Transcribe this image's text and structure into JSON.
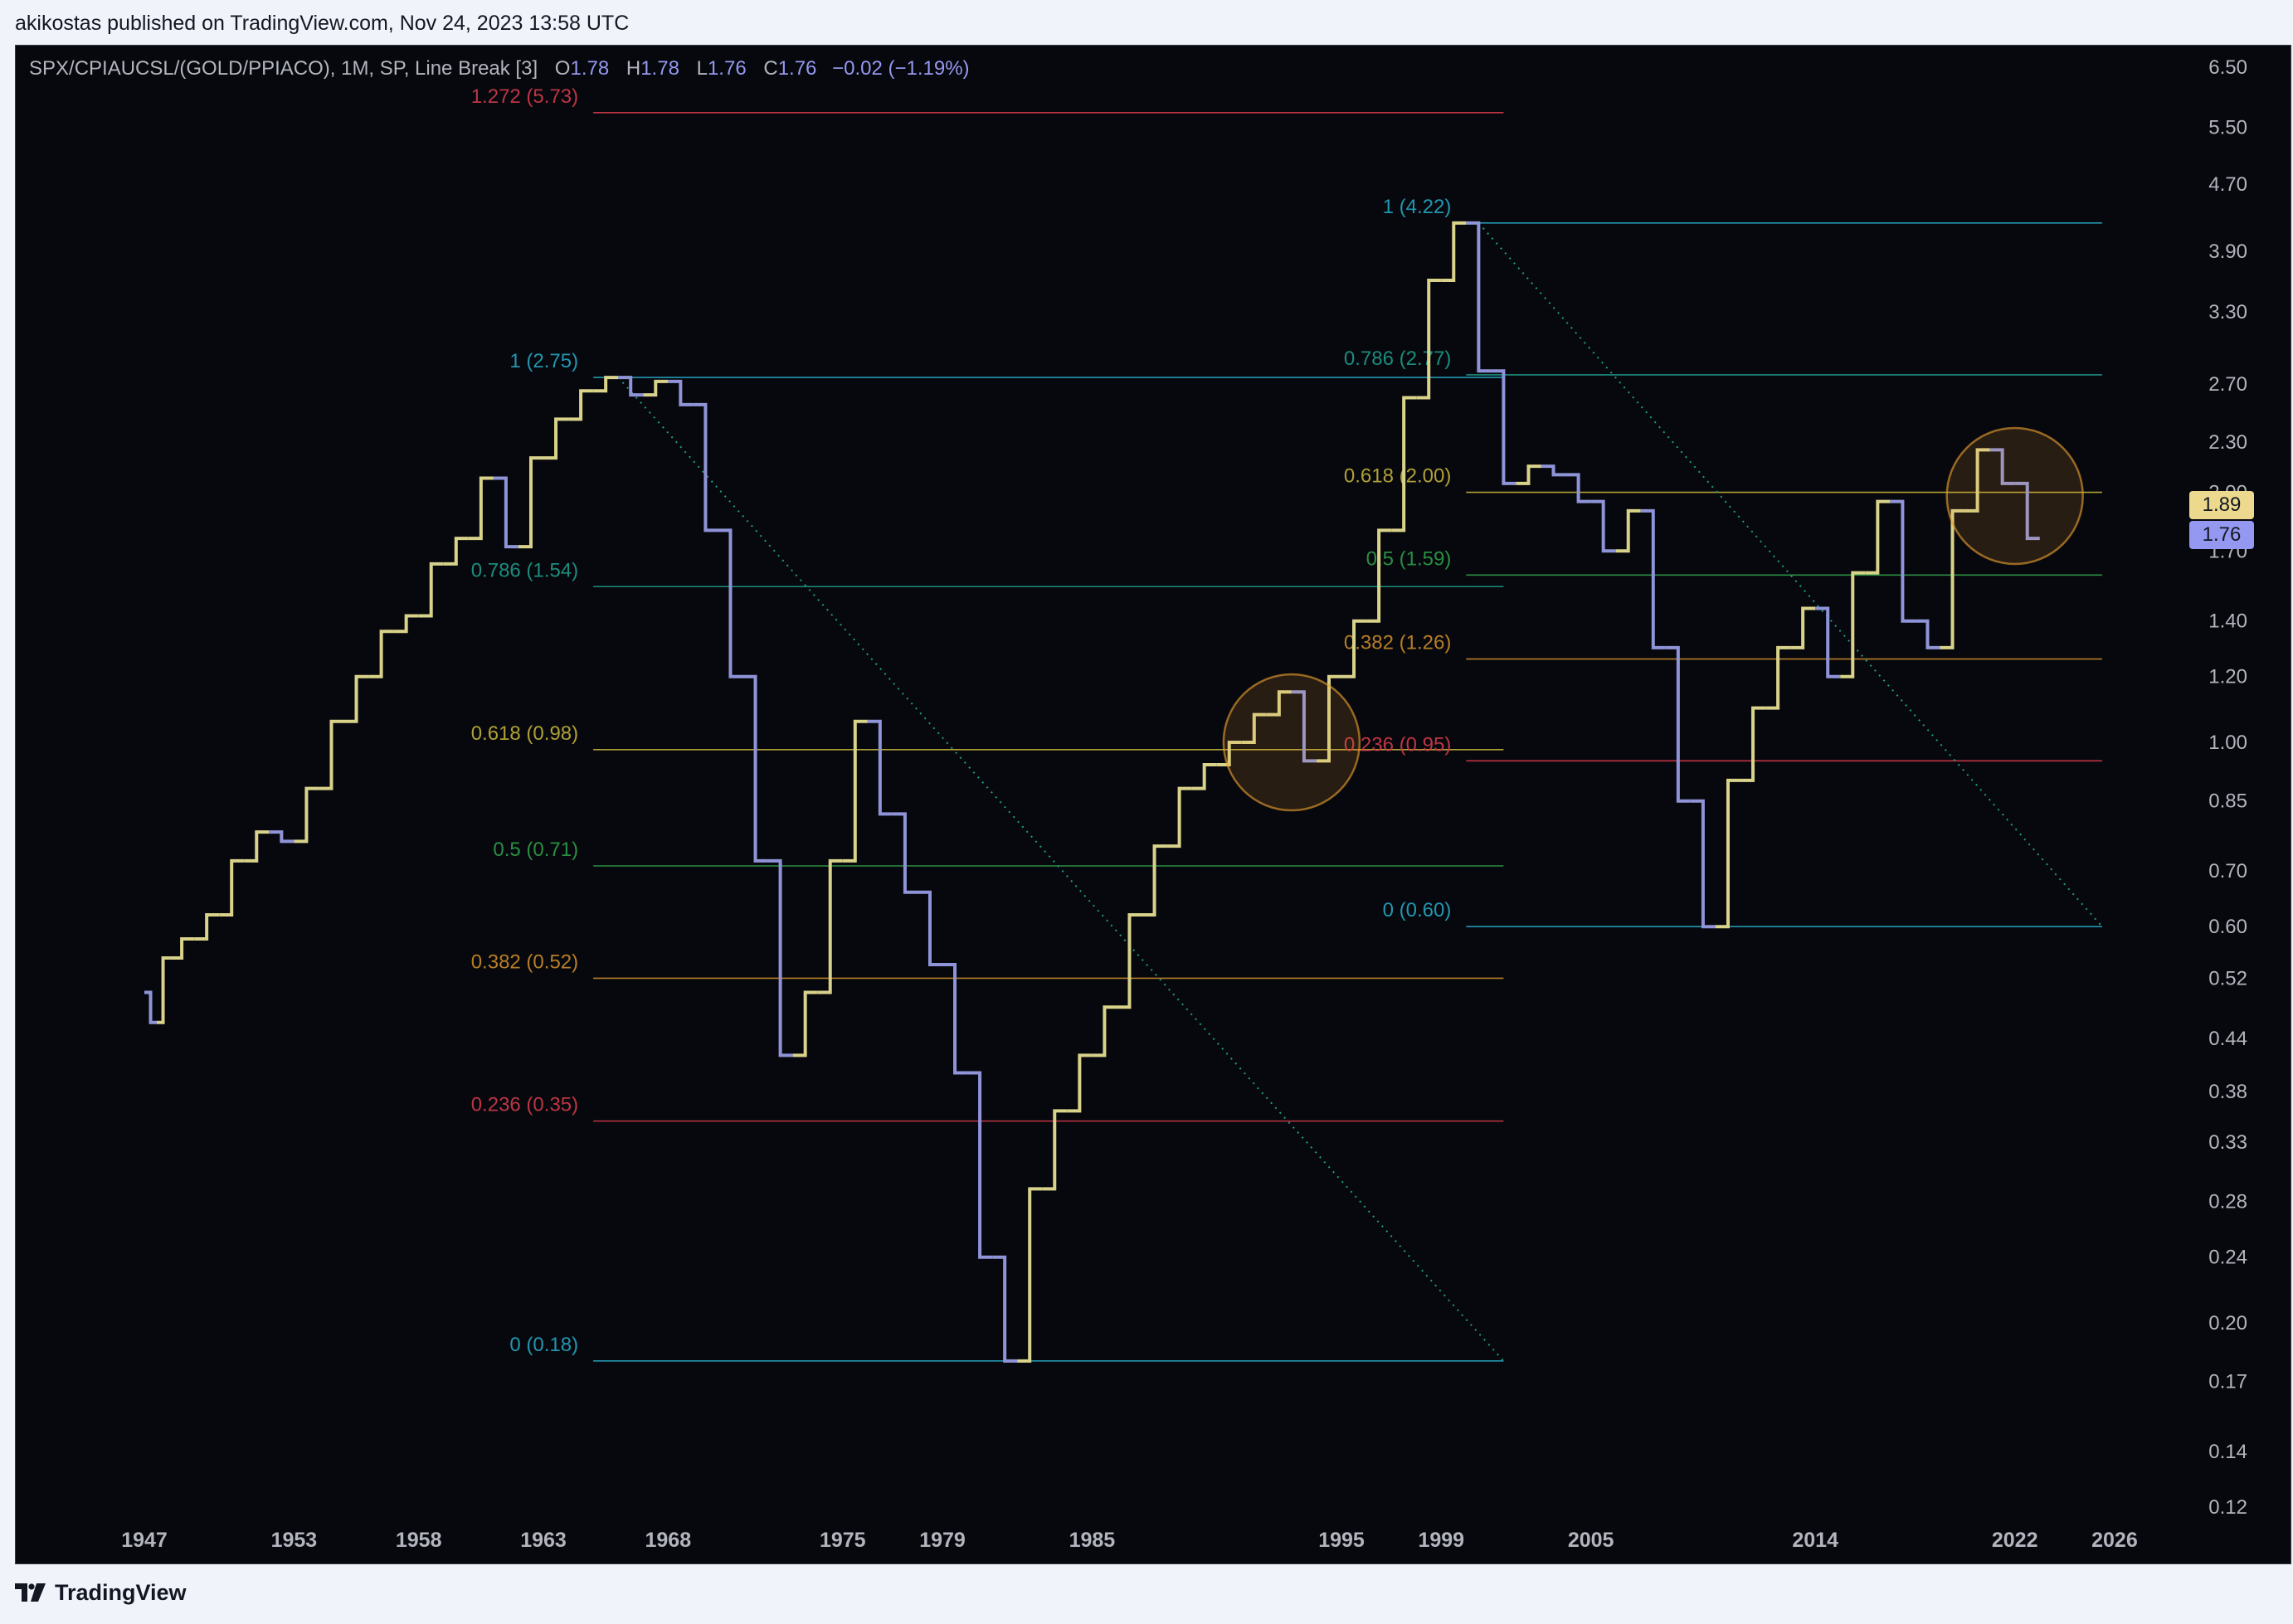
{
  "attribution": "akikostas published on TradingView.com, Nov 24, 2023 13:58 UTC",
  "legend": {
    "symbol": "SPX/CPIAUCSL/(GOLD/PPIACO), 1M, SP, Line Break [3]",
    "open_label": "O",
    "open": "1.78",
    "high_label": "H",
    "high": "1.78",
    "low_label": "L",
    "low": "1.76",
    "close_label": "C",
    "close": "1.76",
    "change": "−0.02 (−1.19%)"
  },
  "price_tags": {
    "upper": {
      "value": "1.89",
      "color": "#ecd98d"
    },
    "lower": {
      "value": "1.76",
      "color": "#9598f0"
    }
  },
  "footer": {
    "brand": "TradingView",
    "logo_icon": "tradingview-logo-icon"
  },
  "colors": {
    "up": "#d8d28a",
    "down": "#8f94d8",
    "background": "#07080d",
    "fib_1": "#26a6c2",
    "fib_0786": "#1f9b8a",
    "fib_0618": "#c2b13c",
    "fib_05": "#2e9e48",
    "fib_0382": "#c98b2a",
    "fib_0236": "#d13a4a",
    "fib_1272": "#d13a4a",
    "circle": "#f0a330"
  },
  "chart_data": {
    "type": "line",
    "scale": "log",
    "ylim": [
      0.11,
      6.9
    ],
    "y_ticks": [
      "6.50",
      "5.50",
      "4.70",
      "3.90",
      "3.30",
      "2.70",
      "2.30",
      "2.00",
      "1.70",
      "1.40",
      "1.20",
      "1.00",
      "0.85",
      "0.70",
      "0.60",
      "0.52",
      "0.44",
      "0.38",
      "0.33",
      "0.28",
      "0.24",
      "0.20",
      "0.17",
      "0.14",
      "0.12"
    ],
    "x_ticks": [
      "1947",
      "1953",
      "1958",
      "1963",
      "1968",
      "1975",
      "1979",
      "1985",
      "1995",
      "1999",
      "2005",
      "2014",
      "2022",
      "2026"
    ],
    "series": [
      {
        "x": [
          1947,
          1947.5,
          1948,
          1949,
          1950,
          1951,
          1952,
          1953,
          1954,
          1955,
          1956,
          1957,
          1958,
          1959,
          1960,
          1961,
          1962,
          1963,
          1964,
          1965,
          1966,
          1967,
          1968,
          1969,
          1970,
          1971,
          1972,
          1973,
          1974,
          1975,
          1976,
          1977,
          1978,
          1979,
          1980,
          1981,
          1982,
          1983,
          1984,
          1985,
          1986,
          1987,
          1988,
          1989,
          1990,
          1991,
          1992,
          1993,
          1994,
          1995,
          1996,
          1997,
          1998,
          1999,
          2000,
          2001,
          2002,
          2003,
          2004,
          2005,
          2006,
          2007,
          2008,
          2009,
          2010,
          2011,
          2012,
          2013,
          2014,
          2015,
          2016,
          2017,
          2018,
          2019,
          2020,
          2021,
          2022,
          2023
        ],
        "y": [
          0.5,
          0.46,
          0.55,
          0.58,
          0.62,
          0.72,
          0.78,
          0.76,
          0.88,
          1.06,
          1.2,
          1.36,
          1.42,
          1.64,
          1.76,
          2.08,
          1.72,
          2.2,
          2.45,
          2.65,
          2.75,
          2.62,
          2.72,
          2.55,
          1.8,
          1.2,
          0.72,
          0.42,
          0.5,
          0.72,
          1.06,
          0.82,
          0.66,
          0.54,
          0.4,
          0.24,
          0.18,
          0.29,
          0.36,
          0.42,
          0.48,
          0.62,
          0.75,
          0.88,
          0.94,
          1.0,
          1.08,
          1.15,
          0.95,
          1.2,
          1.4,
          1.8,
          2.6,
          3.6,
          4.22,
          2.8,
          2.05,
          2.15,
          2.1,
          1.95,
          1.7,
          1.9,
          1.3,
          0.85,
          0.6,
          0.9,
          1.1,
          1.3,
          1.45,
          1.2,
          1.6,
          1.95,
          1.4,
          1.3,
          1.9,
          2.25,
          2.05,
          1.76
        ]
      }
    ],
    "fib_left": {
      "levels": [
        {
          "ratio": "1.272",
          "value": 5.73,
          "label": "1.272 (5.73)",
          "color_key": "fib_1272"
        },
        {
          "ratio": "1",
          "value": 2.75,
          "label": "1 (2.75)",
          "color_key": "fib_1"
        },
        {
          "ratio": "0.786",
          "value": 1.54,
          "label": "0.786 (1.54)",
          "color_key": "fib_0786"
        },
        {
          "ratio": "0.618",
          "value": 0.98,
          "label": "0.618 (0.98)",
          "color_key": "fib_0618"
        },
        {
          "ratio": "0.5",
          "value": 0.71,
          "label": "0.5 (0.71)",
          "color_key": "fib_05"
        },
        {
          "ratio": "0.382",
          "value": 0.52,
          "label": "0.382 (0.52)",
          "color_key": "fib_0382"
        },
        {
          "ratio": "0.236",
          "value": 0.35,
          "label": "0.236 (0.35)",
          "color_key": "fib_0236"
        },
        {
          "ratio": "0",
          "value": 0.18,
          "label": "0 (0.18)",
          "color_key": "fib_1"
        }
      ],
      "x_start": 1965,
      "x_end": 2001.5,
      "trend_from": [
        1966,
        2.75
      ],
      "trend_to": [
        2001.5,
        0.18
      ]
    },
    "fib_right": {
      "levels": [
        {
          "ratio": "1",
          "value": 4.22,
          "label": "1 (4.22)",
          "color_key": "fib_1"
        },
        {
          "ratio": "0.786",
          "value": 2.77,
          "label": "0.786 (2.77)",
          "color_key": "fib_0786"
        },
        {
          "ratio": "0.618",
          "value": 2.0,
          "label": "0.618 (2.00)",
          "color_key": "fib_0618"
        },
        {
          "ratio": "0.5",
          "value": 1.59,
          "label": "0.5 (1.59)",
          "color_key": "fib_05"
        },
        {
          "ratio": "0.382",
          "value": 1.26,
          "label": "0.382 (1.26)",
          "color_key": "fib_0382"
        },
        {
          "ratio": "0.236",
          "value": 0.95,
          "label": "0.236 (0.95)",
          "color_key": "fib_0236"
        },
        {
          "ratio": "0",
          "value": 0.6,
          "label": "0 (0.60)",
          "color_key": "fib_1"
        }
      ],
      "x_start": 2000,
      "x_end": 2025.5,
      "trend_from": [
        2000.5,
        4.22
      ],
      "trend_to": [
        2025.5,
        0.6
      ]
    },
    "highlights": [
      {
        "x": 1993,
        "y": 1.0
      },
      {
        "x": 2022,
        "y": 1.98
      }
    ]
  }
}
